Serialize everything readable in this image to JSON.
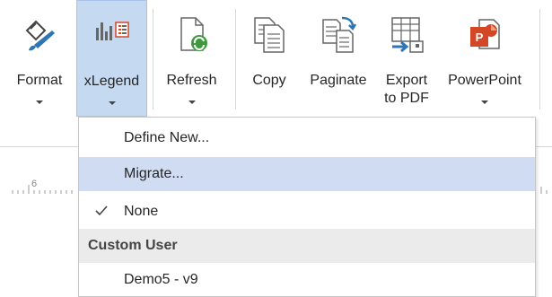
{
  "ribbon": {
    "buttons": [
      {
        "label": "Format",
        "icon": "paint-brush-icon",
        "dropdown": true
      },
      {
        "label": "xLegend",
        "icon": "legend-chart-icon",
        "dropdown": true,
        "active": true
      },
      {
        "label": "Refresh",
        "icon": "refresh-page-icon",
        "dropdown": true
      },
      {
        "label": "Copy",
        "icon": "copy-icon",
        "dropdown": false
      },
      {
        "label": "Paginate",
        "icon": "paginate-icon",
        "dropdown": false
      },
      {
        "label": "Export",
        "label2": "to PDF",
        "icon": "export-pdf-icon",
        "dropdown": false
      },
      {
        "label": "PowerPoint",
        "icon": "powerpoint-icon",
        "dropdown": true
      }
    ]
  },
  "ruler": {
    "number": "6"
  },
  "menu": {
    "items": [
      {
        "label": "Define New...",
        "highlight": false,
        "checked": false
      },
      {
        "label": "Migrate...",
        "highlight": true,
        "checked": false
      },
      {
        "label": "None",
        "highlight": false,
        "checked": true
      }
    ],
    "section_header": "Custom User",
    "custom_items": [
      {
        "label": "Demo5 - v9"
      }
    ]
  },
  "colors": {
    "active_button_bg": "#c5d9f1",
    "menu_highlight": "#d0dcf2",
    "section_bg": "#ebebeb",
    "refresh_green": "#3c9a3c",
    "ppt_orange": "#d24726",
    "blue_accent": "#2e75b6"
  }
}
